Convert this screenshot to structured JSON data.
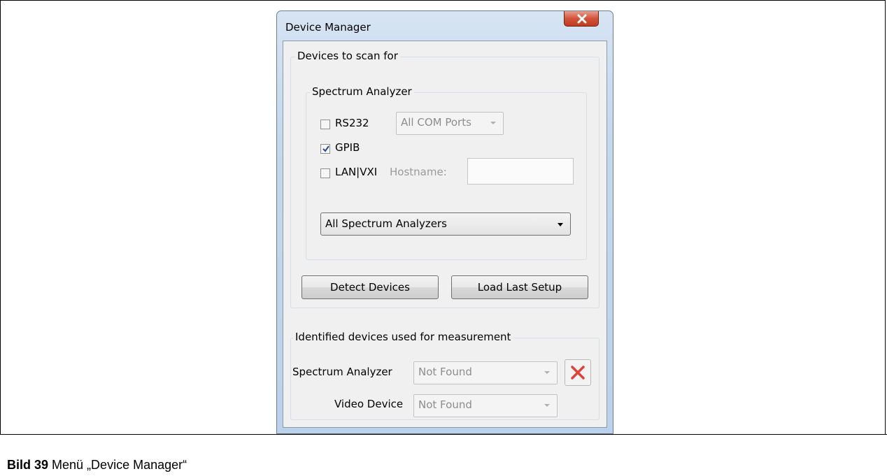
{
  "window": {
    "title": "Device Manager"
  },
  "scan_group": {
    "legend": "Devices to scan for"
  },
  "spectrum_group": {
    "legend": "Spectrum Analyzer",
    "rs232": {
      "label": "RS232",
      "checked": false
    },
    "rs232_port": {
      "value": "All COM Ports"
    },
    "gpib": {
      "label": "GPIB",
      "checked": true
    },
    "lan": {
      "label": "LAN|VXI",
      "checked": false
    },
    "hostname": {
      "label": "Hostname:",
      "value": ""
    },
    "analyzer_select": {
      "value": "All Spectrum Analyzers"
    }
  },
  "buttons": {
    "detect": "Detect Devices",
    "load_last": "Load Last Setup"
  },
  "identified_group": {
    "legend": "Identified devices used for measurement",
    "spectrum_label": "Spectrum Analyzer",
    "spectrum_value": "Not Found",
    "video_label": "Video Device",
    "video_value": "Not Found"
  },
  "caption": {
    "bold": "Bild 39",
    "text": " Menü „Device Manager“"
  },
  "icons": {
    "close": "close-icon",
    "delete": "delete-x-icon",
    "check": "checkmark-icon"
  },
  "colors": {
    "delete_red": "#e0423a",
    "close_red": "#c7432a",
    "check_blue": "#2a4a8e"
  }
}
